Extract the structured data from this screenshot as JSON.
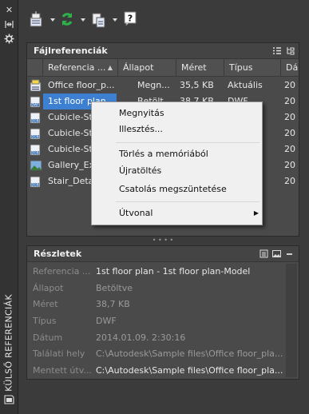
{
  "palette": {
    "title": "KÜLSŐ REFERENCIÁK"
  },
  "file_refs": {
    "title": "Fájlreferenciák",
    "columns": [
      "Referencia ...",
      "Állapot",
      "Méret",
      "Típus",
      "Dá"
    ],
    "rows": [
      {
        "icon": "dwg-file-icon",
        "name": "Office floor_p...",
        "status": "Megn...",
        "size": "35,5 KB",
        "type": "Aktuális",
        "date": "20"
      },
      {
        "icon": "dwf-file-icon",
        "name": "1st floor plan",
        "status": "Betölt...",
        "size": "38,7 KB",
        "type": "DWF",
        "date": "20",
        "selected": true
      },
      {
        "icon": "dgn-file-icon",
        "name": "Cubicle-Ste...",
        "status": "",
        "size": "",
        "type": "",
        "date": "20"
      },
      {
        "icon": "dgn-file-icon",
        "name": "Cubicle-Ste...",
        "status": "",
        "size": "",
        "type": "",
        "date": "20"
      },
      {
        "icon": "dgn-file-icon",
        "name": "Cubicle-Ste...",
        "status": "",
        "size": "",
        "type": "",
        "date": "20"
      },
      {
        "icon": "image-file-icon",
        "name": "Gallery_Ext...",
        "status": "",
        "size": "",
        "type": "",
        "date": "20"
      },
      {
        "icon": "dgn-file-icon",
        "name": "Stair_Detai...",
        "status": "",
        "size": "",
        "type": "",
        "date": "20"
      }
    ]
  },
  "context_menu": {
    "open": "Megnyitás",
    "attach": "Illesztés...",
    "unload": "Törlés a memóriából",
    "reload": "Újratöltés",
    "detach": "Csatolás megszüntetése",
    "path": "Útvonal"
  },
  "details": {
    "title": "Részletek",
    "rows": [
      {
        "label": "Referencia ...",
        "value": "1st floor plan - 1st floor plan-Model",
        "highlight": true
      },
      {
        "label": "Állapot",
        "value": "Betöltve",
        "highlight": false
      },
      {
        "label": "Méret",
        "value": "38,7 KB",
        "highlight": false
      },
      {
        "label": "Típus",
        "value": "DWF",
        "highlight": false
      },
      {
        "label": "Dátum",
        "value": "2014.01.09. 2:30:16",
        "highlight": false
      },
      {
        "label": "Találati hely",
        "value": "C:\\Autodesk\\Sample files\\Office floor_pla...",
        "highlight": false
      },
      {
        "label": "Mentett útv...",
        "value": "C:\\Autodesk\\Sample files\\Office floor_pla...",
        "highlight": true
      }
    ]
  },
  "colors": {
    "background": "#3b3b3b",
    "selection": "#3d7fd0",
    "menu_bg": "#f0f0f0",
    "refresh_icon": "#2db34a"
  }
}
